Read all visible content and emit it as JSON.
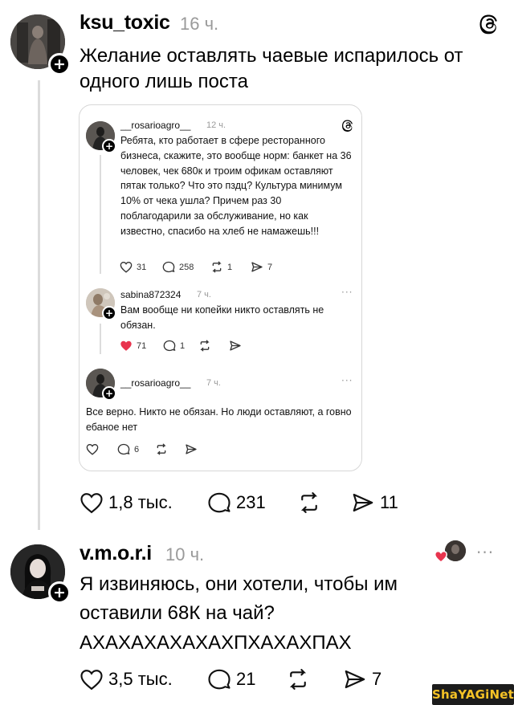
{
  "post1": {
    "username": "ksu_toxic",
    "time": "16 ч.",
    "text": "Желание оставлять чаевые испарилось от одного лишь поста",
    "likes": "1,8 тыс.",
    "comments": "231",
    "shares": "11"
  },
  "quote": {
    "post": {
      "username": "__rosarioagro__",
      "time": "12 ч.",
      "text": "Ребята, кто работает в сфере ресторанного бизнеса, скажите, это вообще норм: банкет на 36 человек, чек 680к и троим офикам оставляют пятак только? Что это пздц? Культура минимум 10% от чека ушла? Причем раз 30 поблагодарили за обслуживание, но как известно, спасибо на хлеб не намажешь!!!",
      "likes": "31",
      "comments": "258",
      "reposts": "1",
      "shares": "7"
    },
    "reply1": {
      "username": "sabina872324",
      "time": "7 ч.",
      "text": "Вам вообще ни копейки никто оставлять не обязан.",
      "likes": "71",
      "comments": "1",
      "more": "···"
    },
    "reply2": {
      "username": "__rosarioagro__",
      "time": "7 ч.",
      "text": "Все верно. Никто не обязан. Но люди оставляют, а говно ебаное нет",
      "comments": "6",
      "more": "···"
    }
  },
  "post2": {
    "username": "v.m.o.r.i",
    "time": "10 ч.",
    "text": "Я извиняюсь, они хотели, чтобы им оставили 68К на чай? АХАХАХАХАХАХПХАХАХПАХ",
    "likes": "3,5 тыс.",
    "comments": "21",
    "shares": "7",
    "more": "···"
  },
  "watermark": "ShaYAGiNet",
  "colors": {
    "like_red": "#e8344e",
    "muted": "#9a9a9a",
    "border": "#d7d7d7"
  }
}
